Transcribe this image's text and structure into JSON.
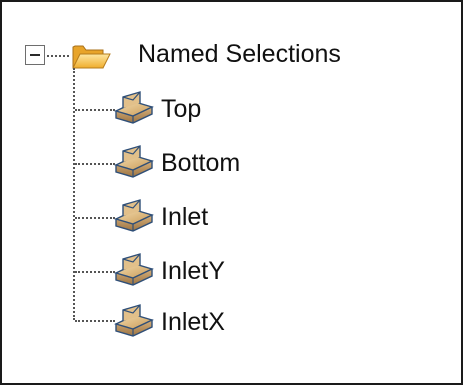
{
  "tree": {
    "root": {
      "label": "Named Selections",
      "expanded": true,
      "icon": "folder-open-icon"
    },
    "children": [
      {
        "label": "Top",
        "icon": "named-selection-icon"
      },
      {
        "label": "Bottom",
        "icon": "named-selection-icon"
      },
      {
        "label": "Inlet",
        "icon": "named-selection-icon"
      },
      {
        "label": "InletY",
        "icon": "named-selection-icon"
      },
      {
        "label": "InletX",
        "icon": "named-selection-icon"
      }
    ]
  },
  "colors": {
    "folder": "#f2b93b",
    "selection_icon": "#c9a46a",
    "selection_icon_edge": "#3a5f8f",
    "border": "#1a1a1a"
  }
}
